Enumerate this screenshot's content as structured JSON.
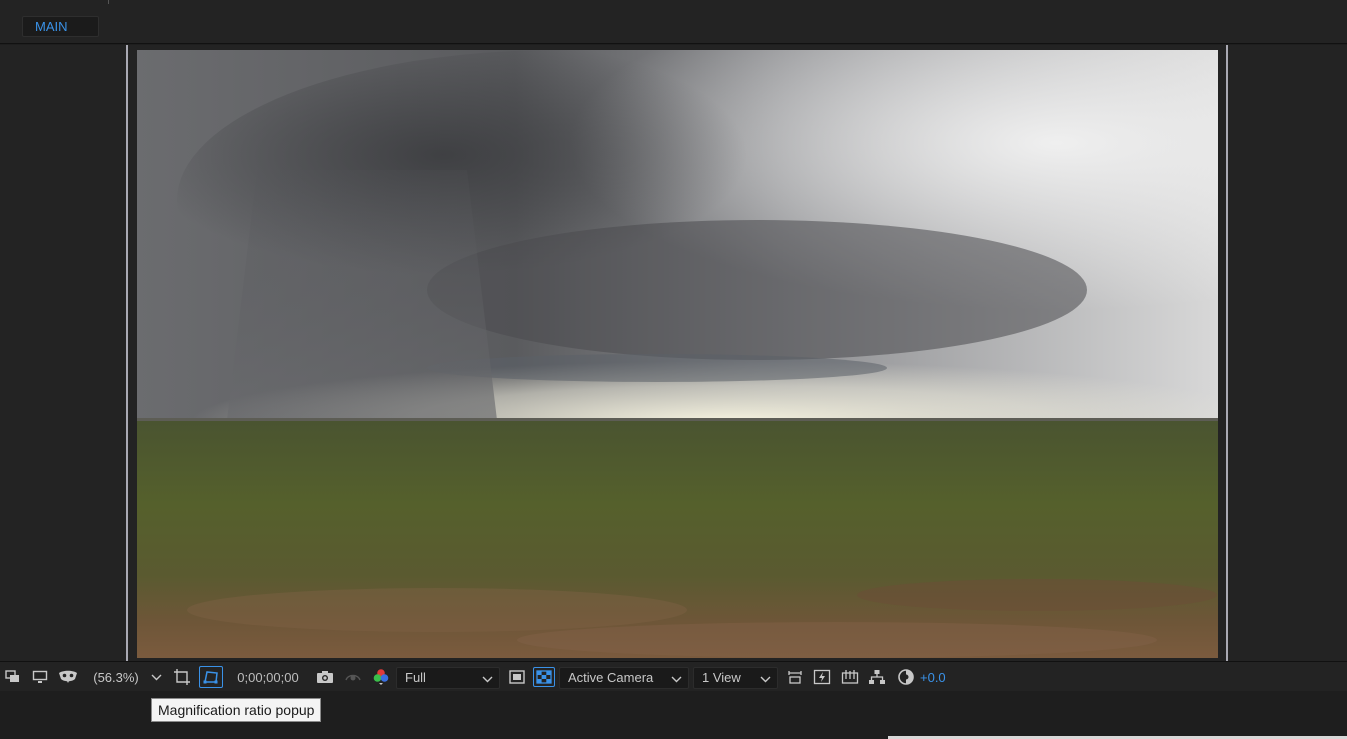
{
  "panel": {
    "tab_label": "MAIN"
  },
  "viewer": {
    "footage": {
      "subject": "storm-over-grassland",
      "sky_colors": [
        "#5e5f62",
        "#9c9d9f",
        "#eeeeec",
        "#f4f1df"
      ],
      "ground_colors": [
        "#4e5a2c",
        "#5c5a30",
        "#7a5a3c"
      ]
    }
  },
  "toolbar": {
    "magnification": "(56.3%)",
    "timecode": "0;00;00;00",
    "resolution": "Full",
    "camera": "Active Camera",
    "view_layout": "1 View",
    "exposure": "+0.0",
    "accent_color": "#3a92e8"
  },
  "tooltip": {
    "text": "Magnification ratio popup"
  }
}
